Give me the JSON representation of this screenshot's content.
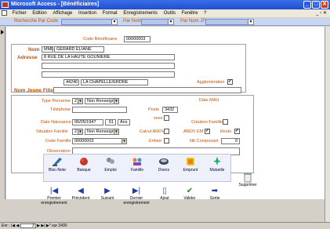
{
  "window": {
    "title": "Microsoft Access - [Bénéficiaires]",
    "controls": [
      "_",
      "□",
      "✕"
    ]
  },
  "menu": {
    "items": [
      "Fichier",
      "Edition",
      "Affichage",
      "Insertion",
      "Format",
      "Enregistrements",
      "Outils",
      "Fenêtre",
      "?"
    ],
    "right_controls": "_ ▫ ✕"
  },
  "search": {
    "by_code_label": "Recherche Par Code",
    "by_name_label": "Par Nom",
    "by_name_jf_label": "Par Nom JF",
    "dropdown_arrow": "▼"
  },
  "form": {
    "code_label": "Code Bénéficiaire",
    "code_value": "00000003",
    "nom_label": "Nom",
    "civilite": "MME",
    "nom_value": "GERARD ELIANE",
    "adresse_label": "Adresse",
    "adresse_line1": "8 RUE DE LA HAUTE GOUNIERE",
    "adresse_line2": "",
    "adresse_line3": "",
    "code_postal": "44240",
    "ville": "LA CHAPELLE/ERDRE",
    "agglomeration_label": "Agglomération",
    "agglomeration_checked": true,
    "nom_jeune_fille_label": "Nom Jeune Fille",
    "nom_jeune_fille_value": "",
    "type_personne_label": "Type Personne",
    "type_personne_code": "2",
    "type_personne_value": "Non Renseigne",
    "date_mau_label": "Date MAU",
    "telephone_label": "Téléphone",
    "telephone_value": "",
    "poste_label": "Poste",
    "poste_value": "3432",
    "sexe_label": "sexe",
    "date_naissance_label": "Date Naissance",
    "date_naissance_value": "06/05/1947",
    "age_value": "61",
    "age_unit": "Ans",
    "creation_famille_label": "Création Famille",
    "situation_famille_label": "Situation Famille",
    "situation_famille_code": "2",
    "situation_famille_value": "Non Renseigne",
    "calcul_anov_label": "Calcul ANOV",
    "anov_em_label": "ANOV EM",
    "anov_em_checked": true,
    "resto_label": "Resto",
    "resto_checked": true,
    "code_famille_label": "Code Famille",
    "code_famille_value": "00000003",
    "enfant_label": "Enfant",
    "nb_composant_label": "Nb Composant",
    "nb_composant_value": "0",
    "observation_label": "Observation",
    "observation_value": ""
  },
  "icon_buttons": [
    {
      "label": "Bloc-Note",
      "icon": "notepad-icon"
    },
    {
      "label": "Banque",
      "icon": "bank-icon"
    },
    {
      "label": "Emploi",
      "icon": "employment-icon"
    },
    {
      "label": "Famille",
      "icon": "family-icon"
    },
    {
      "label": "Divers",
      "icon": "misc-icon"
    },
    {
      "label": "Emprunt",
      "icon": "loan-icon"
    },
    {
      "label": "Mutuelle",
      "icon": "mutual-icon"
    }
  ],
  "nav_buttons": [
    {
      "label": "Premier enregistrement",
      "symbol": "|◀"
    },
    {
      "label": "Précédent",
      "symbol": "◀"
    },
    {
      "label": "Suivant",
      "symbol": "▶"
    },
    {
      "label": "Dernier enregistrement",
      "symbol": "▶|"
    },
    {
      "label": "Ajout",
      "symbol": "▯"
    },
    {
      "label": "Valider",
      "symbol": "✔"
    },
    {
      "label": "Sortie",
      "symbol": "➡"
    }
  ],
  "delete_button": {
    "label": "Supprimer",
    "icon": "trash-icon"
  },
  "status": {
    "record_label": "Enr :",
    "current_record": "3",
    "of_label": "sur",
    "total_records": "2430"
  },
  "colors": {
    "title_blue": "#1f4fd0",
    "label_orange": "#c85000",
    "nav_blue": "#1f3fa0",
    "search_bar": "#c9d6f0"
  }
}
